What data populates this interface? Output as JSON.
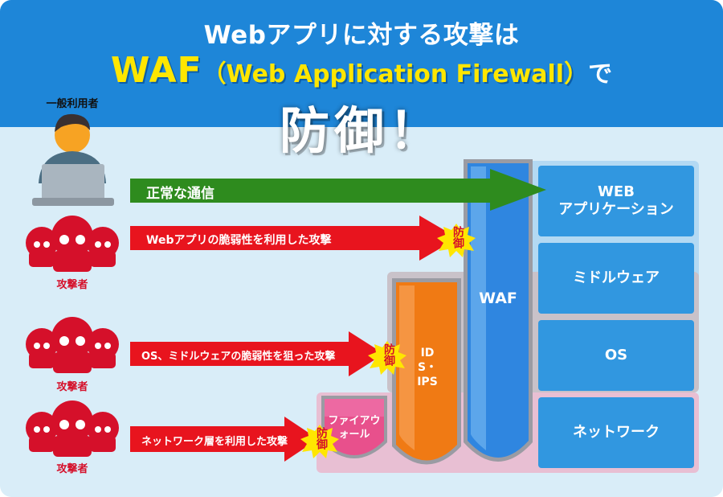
{
  "header": {
    "line1": "Webアプリに対する攻撃は",
    "line2_main": "WAF",
    "line2_paren": "（Web Application Firewall）",
    "line2_suffix": "で",
    "line3": "防御！"
  },
  "actors": {
    "user_label": "一般利用者",
    "attacker_label_1": "攻撃者",
    "attacker_label_2": "攻撃者",
    "attacker_label_3": "攻撃者"
  },
  "flows": [
    {
      "label": "正常な通信"
    },
    {
      "label": "Webアプリの脆弱性を利用した攻撃"
    },
    {
      "label": "OS、ミドルウェアの脆弱性を狙った攻撃"
    },
    {
      "label": "ネットワーク層を利用した攻撃"
    }
  ],
  "defense_badge": "防御",
  "defenses": {
    "firewall_label": "ファイアウォール",
    "ids_ips_label": "IDS・IPS",
    "waf_label": "WAF"
  },
  "layers": [
    {
      "label": "WEB\nアプリケーション"
    },
    {
      "label": "ミドルウェア"
    },
    {
      "label": "OS"
    },
    {
      "label": "ネットワーク"
    }
  ],
  "colors": {
    "header_blue": "#1e86d8",
    "title_yellow": "#ffe600",
    "normal_flow_green": "#2e8b1e",
    "attack_red": "#e8141e",
    "layer_blue": "#3197e0",
    "waf_blue": "#2f86e0",
    "ids_orange": "#f07a14",
    "firewall_pink": "#e8508c"
  }
}
